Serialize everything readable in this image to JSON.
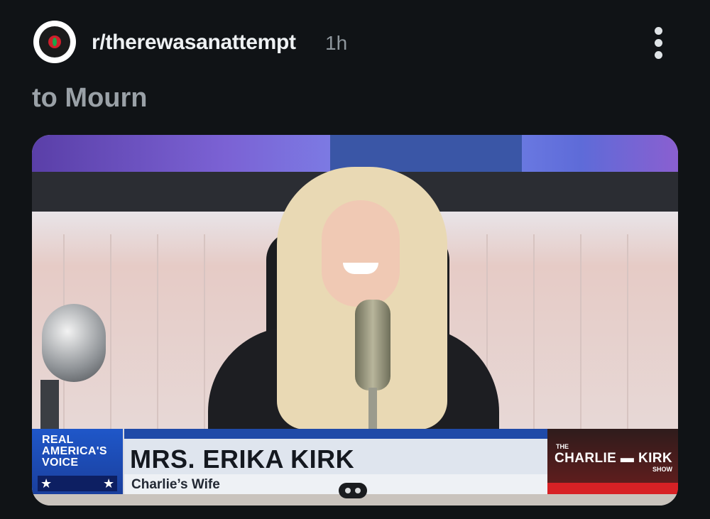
{
  "post": {
    "subreddit": "r/therewasanattempt",
    "time": "1h",
    "title": "to Mourn"
  },
  "image_overlay": {
    "network": {
      "line1": "REAL",
      "line2": "AMERICA'S",
      "line3": "VOICE",
      "stars": [
        "★",
        "★"
      ]
    },
    "name": "MRS. ERIKA KIRK",
    "role": "Charlie’s Wife",
    "show": {
      "top": "THE",
      "main": "CHARLIE ▬ KIRK",
      "bottom": "SHOW"
    }
  },
  "icons": [
    "subreddit-avatar-icon",
    "more-options-icon",
    "carousel-pager-icon"
  ],
  "colors": {
    "background": "#101316",
    "title": "#9aa1a7",
    "network_blue": "#1f57c9",
    "show_red": "#d72125"
  }
}
